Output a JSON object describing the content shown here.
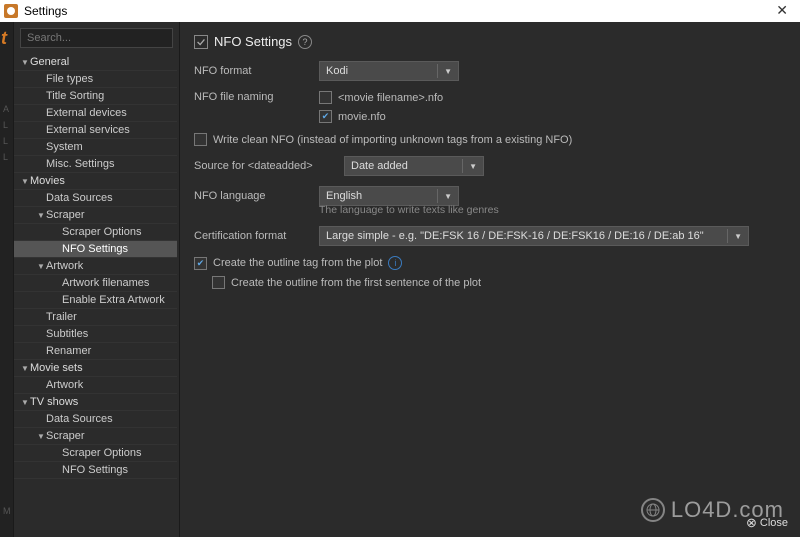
{
  "titlebar": {
    "title": "Settings"
  },
  "search": {
    "placeholder": "Search..."
  },
  "sidebar": {
    "items": [
      {
        "label": "General",
        "lvl": 0,
        "exp": "▼"
      },
      {
        "label": "File types",
        "lvl": 1
      },
      {
        "label": "Title Sorting",
        "lvl": 1
      },
      {
        "label": "External devices",
        "lvl": 1
      },
      {
        "label": "External services",
        "lvl": 1
      },
      {
        "label": "System",
        "lvl": 1
      },
      {
        "label": "Misc. Settings",
        "lvl": 1
      },
      {
        "label": "Movies",
        "lvl": 0,
        "exp": "▼"
      },
      {
        "label": "Data Sources",
        "lvl": 1
      },
      {
        "label": "Scraper",
        "lvl": 1,
        "exp": "▼"
      },
      {
        "label": "Scraper Options",
        "lvl": 2
      },
      {
        "label": "NFO Settings",
        "lvl": 2,
        "selected": true
      },
      {
        "label": "Artwork",
        "lvl": 1,
        "exp": "▼"
      },
      {
        "label": "Artwork filenames",
        "lvl": 2
      },
      {
        "label": "Enable Extra Artwork",
        "lvl": 2
      },
      {
        "label": "Trailer",
        "lvl": 1
      },
      {
        "label": "Subtitles",
        "lvl": 1
      },
      {
        "label": "Renamer",
        "lvl": 1
      },
      {
        "label": "Movie sets",
        "lvl": 0,
        "exp": "▼"
      },
      {
        "label": "Artwork",
        "lvl": 1
      },
      {
        "label": "TV shows",
        "lvl": 0,
        "exp": "▼"
      },
      {
        "label": "Data Sources",
        "lvl": 1
      },
      {
        "label": "Scraper",
        "lvl": 1,
        "exp": "▼"
      },
      {
        "label": "Scraper Options",
        "lvl": 2
      },
      {
        "label": "NFO Settings",
        "lvl": 2
      }
    ]
  },
  "content": {
    "header": "NFO Settings",
    "nfo_format_label": "NFO format",
    "nfo_format_value": "Kodi",
    "nfo_file_naming_label": "NFO file naming",
    "naming_opt1": "<movie filename>.nfo",
    "naming_opt2": "movie.nfo",
    "write_clean": "Write clean NFO (instead of importing unknown tags from a existing NFO)",
    "source_label": "Source for <dateadded>",
    "source_value": "Date added",
    "nfo_lang_label": "NFO language",
    "nfo_lang_value": "English",
    "nfo_lang_hint": "The language to write texts like genres",
    "cert_label": "Certification format",
    "cert_value": "Large simple - e.g. \"DE:FSK 16 / DE:FSK-16 / DE:FSK16 / DE:16 / DE:ab 16\"",
    "outline1": "Create the outline tag from the plot",
    "outline2": "Create the outline from the first sentence of the plot"
  },
  "footer": {
    "close": "Close"
  },
  "watermark": "LO4D.com",
  "leftStripLetters": [
    "A",
    "L",
    "L",
    "L",
    "M"
  ]
}
